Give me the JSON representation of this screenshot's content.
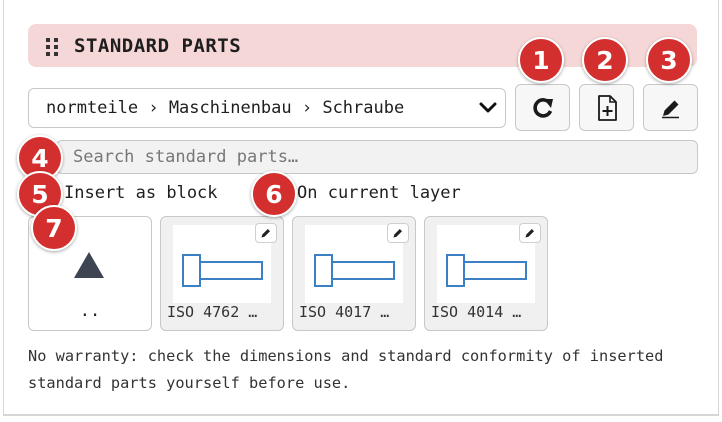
{
  "panel": {
    "title": "STANDARD PARTS"
  },
  "path_select": {
    "value": "normteile › Maschinenbau › Schraube"
  },
  "toolbar": {
    "refresh_icon": "refresh-icon",
    "new_file_icon": "new-file-icon",
    "edit_icon": "pencil-icon"
  },
  "search": {
    "placeholder": "Search standard parts…"
  },
  "options": {
    "insert_as_block": "Insert as block",
    "on_current_layer": "On current layer"
  },
  "tiles": {
    "up": {
      "label": ".."
    },
    "items": [
      {
        "label": "ISO 4762 …"
      },
      {
        "label": "ISO 4017 …"
      },
      {
        "label": "ISO 4014 …"
      }
    ]
  },
  "note": "No warranty: check the dimensions and standard conformity of inserted standard parts yourself before use.",
  "badges": [
    "1",
    "2",
    "3",
    "4",
    "5",
    "6",
    "7"
  ],
  "colors": {
    "header_bg": "#f6d7d7",
    "badge": "#d32f2f",
    "part_stroke": "#3b7fc4"
  }
}
